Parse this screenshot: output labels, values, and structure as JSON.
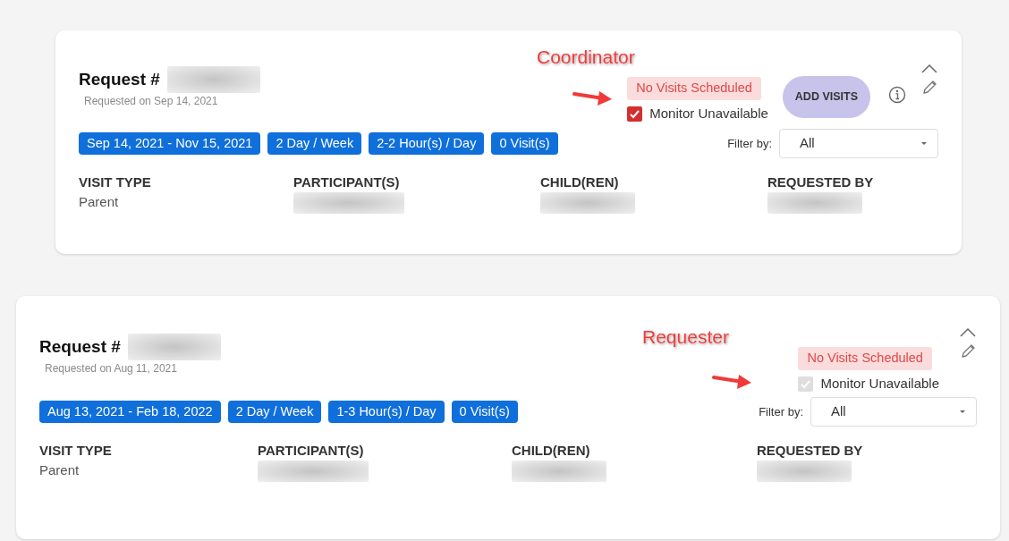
{
  "requests": [
    {
      "annotation": "Coordinator",
      "title": "Request #",
      "requested_on": "Requested on Sep 14, 2021",
      "tags": [
        "Sep 14, 2021 - Nov 15, 2021",
        "2 Day / Week",
        "2-2 Hour(s) / Day",
        "0 Visit(s)"
      ],
      "status": "No Visits Scheduled",
      "monitor": {
        "label": "Monitor Unavailable",
        "checked": true,
        "disabled": false
      },
      "add_visits": "ADD VISITS",
      "info": true,
      "filter": {
        "label": "Filter by:",
        "value": "All"
      },
      "details": [
        {
          "label": "VISIT TYPE",
          "value": "Parent"
        },
        {
          "label": "PARTICIPANT(S)",
          "redacted": true
        },
        {
          "label": "CHILD(REN)",
          "redacted": true
        },
        {
          "label": "REQUESTED BY",
          "redacted": true
        }
      ]
    },
    {
      "annotation": "Requester",
      "title": "Request #",
      "requested_on": "Requested on Aug 11, 2021",
      "tags": [
        "Aug 13, 2021 - Feb 18, 2022",
        "2 Day / Week",
        "1-3 Hour(s) / Day",
        "0 Visit(s)"
      ],
      "status": "No Visits Scheduled",
      "monitor": {
        "label": "Monitor Unavailable",
        "checked": true,
        "disabled": true
      },
      "info": false,
      "filter": {
        "label": "Filter by:",
        "value": "All"
      },
      "details": [
        {
          "label": "VISIT TYPE",
          "value": "Parent"
        },
        {
          "label": "PARTICIPANT(S)",
          "redacted": true
        },
        {
          "label": "CHILD(REN)",
          "redacted": true
        },
        {
          "label": "REQUESTED BY",
          "redacted": true
        }
      ]
    }
  ]
}
